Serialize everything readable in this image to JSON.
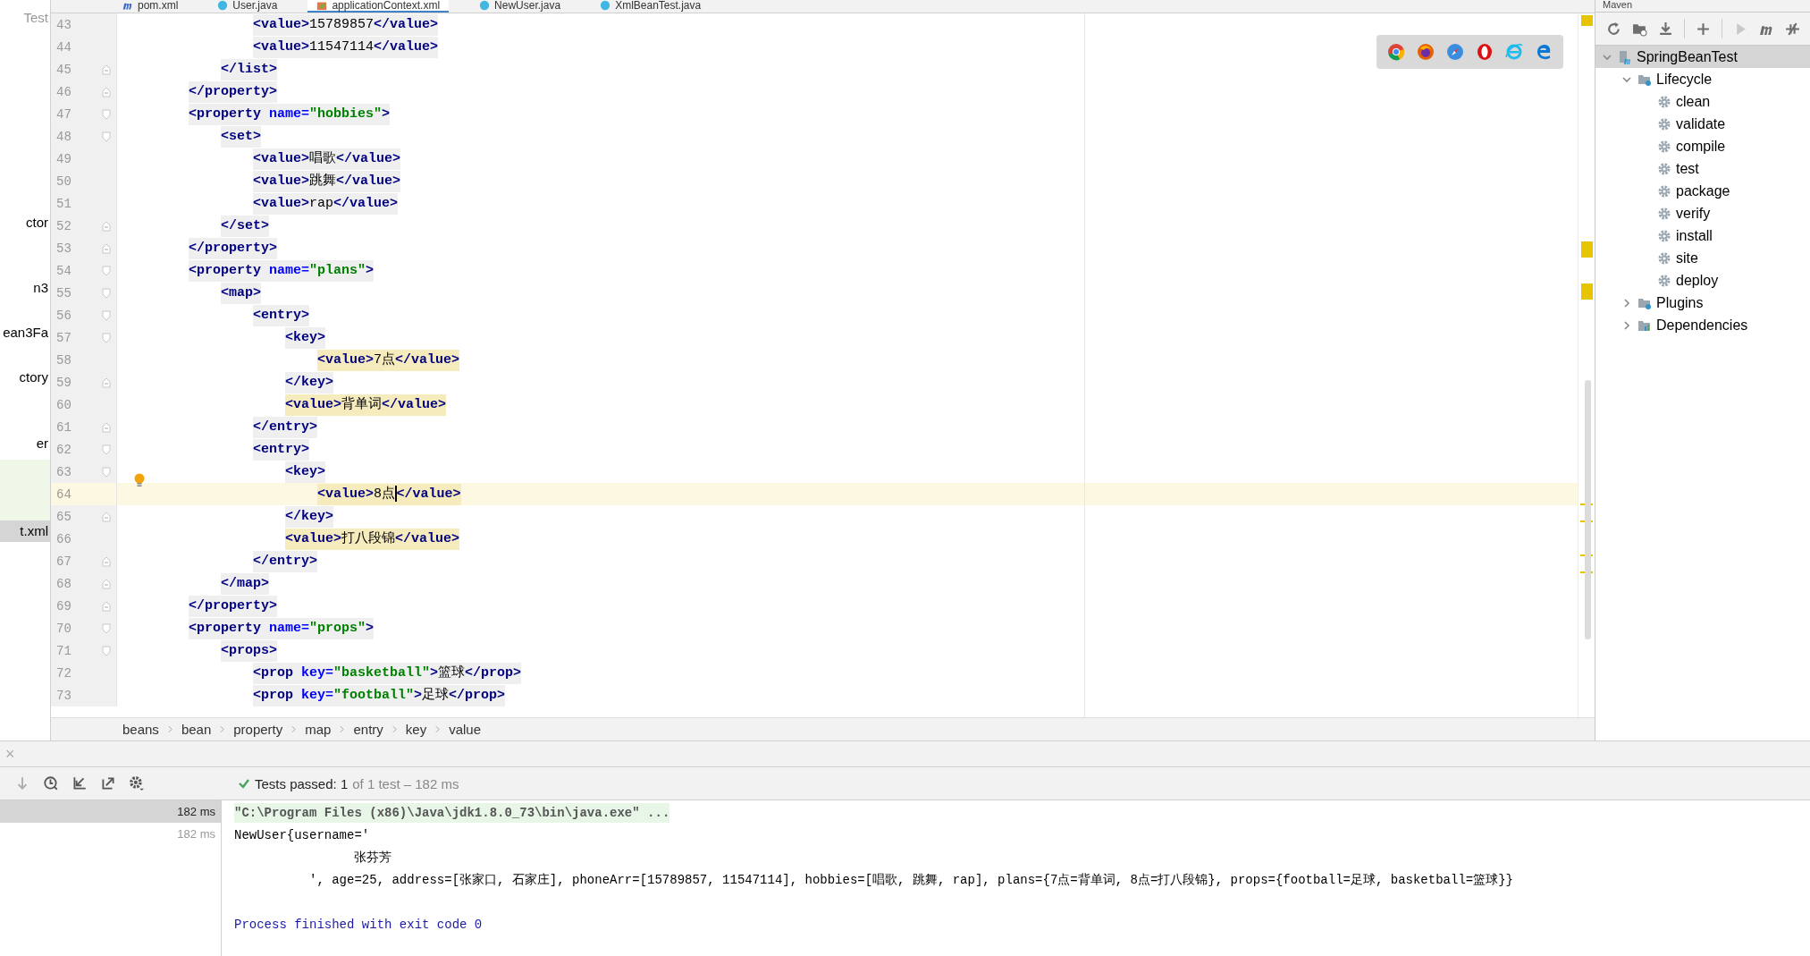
{
  "project_panel": {
    "items": [
      {
        "label": "Test",
        "selected": false
      },
      {
        "label": "ctor",
        "selected": false
      },
      {
        "label": "n3",
        "selected": false
      },
      {
        "label": "ean3Fa",
        "selected": false
      },
      {
        "label": "ctory",
        "selected": false
      },
      {
        "label": "er",
        "selected": false
      },
      {
        "label": "t.xml",
        "selected": true
      }
    ]
  },
  "editor_tabs": [
    {
      "label": "pom.xml",
      "kind": "maven",
      "selected": false
    },
    {
      "label": "User.java",
      "kind": "class",
      "selected": false
    },
    {
      "label": "applicationContext.xml",
      "kind": "spring",
      "selected": true
    },
    {
      "label": "NewUser.java",
      "kind": "class",
      "selected": false
    },
    {
      "label": "XmlBeanTest.java",
      "kind": "class",
      "selected": false
    }
  ],
  "editor": {
    "lines": [
      {
        "number": "43",
        "kind": "element",
        "matched": false,
        "tokens": [
          {
            "kind": "tag",
            "t": "<value>"
          },
          {
            "kind": "text",
            "t": "15789857"
          },
          {
            "kind": "tag",
            "t": "</value>"
          }
        ]
      },
      {
        "number": "44",
        "kind": "element",
        "matched": false,
        "tokens": [
          {
            "kind": "tag",
            "t": "<value>"
          },
          {
            "kind": "text",
            "t": "11547114"
          },
          {
            "kind": "tag",
            "t": "</value>"
          }
        ]
      },
      {
        "number": "45",
        "kind": "close_tag",
        "matched": false,
        "tokens": [
          {
            "kind": "tag",
            "t": "</list>"
          }
        ]
      },
      {
        "number": "46",
        "kind": "close_tag",
        "matched": false,
        "tokens": [
          {
            "kind": "tag",
            "t": "</property>"
          }
        ]
      },
      {
        "number": "47",
        "kind": "open_tag",
        "matched": false,
        "tokens": [
          {
            "kind": "tag",
            "t": "<property "
          },
          {
            "kind": "attr",
            "t": "name="
          },
          {
            "kind": "str",
            "t": "\"hobbies\""
          },
          {
            "kind": "tag",
            "t": ">"
          }
        ]
      },
      {
        "number": "48",
        "kind": "open_tag",
        "matched": false,
        "tokens": [
          {
            "kind": "tag",
            "t": "<set>"
          }
        ]
      },
      {
        "number": "49",
        "kind": "element",
        "matched": false,
        "tokens": [
          {
            "kind": "tag",
            "t": "<value>"
          },
          {
            "kind": "text",
            "t": "唱歌"
          },
          {
            "kind": "tag",
            "t": "</value>"
          }
        ]
      },
      {
        "number": "50",
        "kind": "element",
        "matched": false,
        "tokens": [
          {
            "kind": "tag",
            "t": "<value>"
          },
          {
            "kind": "text",
            "t": "跳舞"
          },
          {
            "kind": "tag",
            "t": "</value>"
          }
        ]
      },
      {
        "number": "51",
        "kind": "element",
        "matched": false,
        "tokens": [
          {
            "kind": "tag",
            "t": "<value>"
          },
          {
            "kind": "text",
            "t": "rap"
          },
          {
            "kind": "tag",
            "t": "</value>"
          }
        ]
      },
      {
        "number": "52",
        "kind": "close_tag",
        "matched": false,
        "tokens": [
          {
            "kind": "tag",
            "t": "</set>"
          }
        ]
      },
      {
        "number": "53",
        "kind": "close_tag",
        "matched": false,
        "tokens": [
          {
            "kind": "tag",
            "t": "</property>"
          }
        ]
      },
      {
        "number": "54",
        "kind": "open_tag",
        "matched": false,
        "tokens": [
          {
            "kind": "tag",
            "t": "<property "
          },
          {
            "kind": "attr",
            "t": "name="
          },
          {
            "kind": "str",
            "t": "\"plans\""
          },
          {
            "kind": "tag",
            "t": ">"
          }
        ]
      },
      {
        "number": "55",
        "kind": "open_tag",
        "matched": false,
        "tokens": [
          {
            "kind": "tag",
            "t": "<map>"
          }
        ]
      },
      {
        "number": "56",
        "kind": "open_tag",
        "matched": false,
        "tokens": [
          {
            "kind": "tag",
            "t": "<entry>"
          }
        ]
      },
      {
        "number": "57",
        "kind": "open_tag",
        "matched": false,
        "tokens": [
          {
            "kind": "tag",
            "t": "<key>"
          }
        ]
      },
      {
        "number": "58",
        "kind": "element",
        "matched": true,
        "tokens": [
          {
            "kind": "tag",
            "t": "<value>"
          },
          {
            "kind": "text",
            "t": "7点"
          },
          {
            "kind": "tag",
            "t": "</value>"
          }
        ]
      },
      {
        "number": "59",
        "kind": "close_tag",
        "matched": false,
        "tokens": [
          {
            "kind": "tag",
            "t": "</key>"
          }
        ]
      },
      {
        "number": "60",
        "kind": "element",
        "matched": true,
        "tokens": [
          {
            "kind": "tag",
            "t": "<value>"
          },
          {
            "kind": "text",
            "t": "背单词"
          },
          {
            "kind": "tag",
            "t": "</value>"
          }
        ]
      },
      {
        "number": "61",
        "kind": "close_tag",
        "matched": false,
        "tokens": [
          {
            "kind": "tag",
            "t": "</entry>"
          }
        ]
      },
      {
        "number": "62",
        "kind": "open_tag",
        "matched": false,
        "tokens": [
          {
            "kind": "tag",
            "t": "<entry>"
          }
        ]
      },
      {
        "number": "63",
        "kind": "open_tag",
        "matched": false,
        "tokens": [
          {
            "kind": "tag",
            "t": "<key>"
          }
        ]
      },
      {
        "number": "64",
        "kind": "element",
        "matched": true,
        "current": true,
        "tokens": [
          {
            "kind": "tag",
            "t": "<value>"
          },
          {
            "kind": "text",
            "t": "8点",
            "caret": true
          },
          {
            "kind": "tag",
            "t": "</value>"
          }
        ]
      },
      {
        "number": "65",
        "kind": "close_tag",
        "matched": false,
        "tokens": [
          {
            "kind": "tag",
            "t": "</key>"
          }
        ]
      },
      {
        "number": "66",
        "kind": "element",
        "matched": true,
        "tokens": [
          {
            "kind": "tag",
            "t": "<value>"
          },
          {
            "kind": "text",
            "t": "打八段锦"
          },
          {
            "kind": "tag",
            "t": "</value>"
          }
        ]
      },
      {
        "number": "67",
        "kind": "close_tag",
        "matched": false,
        "tokens": [
          {
            "kind": "tag",
            "t": "</entry>"
          }
        ]
      },
      {
        "number": "68",
        "kind": "close_tag",
        "matched": false,
        "tokens": [
          {
            "kind": "tag",
            "t": "</map>"
          }
        ]
      },
      {
        "number": "69",
        "kind": "close_tag",
        "matched": false,
        "tokens": [
          {
            "kind": "tag",
            "t": "</property>"
          }
        ]
      },
      {
        "number": "70",
        "kind": "open_tag",
        "matched": false,
        "tokens": [
          {
            "kind": "tag",
            "t": "<property "
          },
          {
            "kind": "attr",
            "t": "name="
          },
          {
            "kind": "str",
            "t": "\"props\""
          },
          {
            "kind": "tag",
            "t": ">"
          }
        ]
      },
      {
        "number": "71",
        "kind": "open_tag",
        "matched": false,
        "tokens": [
          {
            "kind": "tag",
            "t": "<props>"
          }
        ]
      },
      {
        "number": "72",
        "kind": "element",
        "matched": false,
        "tokens": [
          {
            "kind": "tag",
            "t": "<prop "
          },
          {
            "kind": "attr",
            "t": "key="
          },
          {
            "kind": "str",
            "t": "\"basketball\""
          },
          {
            "kind": "tag",
            "t": ">"
          },
          {
            "kind": "text",
            "t": "篮球"
          },
          {
            "kind": "tag",
            "t": "</prop>"
          }
        ]
      },
      {
        "number": "73",
        "kind": "element",
        "matched": false,
        "tokens": [
          {
            "kind": "tag",
            "t": "<prop "
          },
          {
            "kind": "attr",
            "t": "key="
          },
          {
            "kind": "str",
            "t": "\"football\""
          },
          {
            "kind": "tag",
            "t": ">"
          },
          {
            "kind": "text",
            "t": "足球"
          },
          {
            "kind": "tag",
            "t": "</prop>"
          }
        ]
      }
    ],
    "breadcrumbs": [
      "beans",
      "bean",
      "property",
      "map",
      "entry",
      "key",
      "value"
    ]
  },
  "maven": {
    "title": "Maven",
    "tree": [
      {
        "label": "SpringBeanTest",
        "kind": "project",
        "expanded": true,
        "selected": true,
        "children": [
          {
            "label": "Lifecycle",
            "kind": "folder",
            "expanded": true,
            "selected": false,
            "children": [
              {
                "label": "clean",
                "kind": "goal",
                "selected": false
              },
              {
                "label": "validate",
                "kind": "goal",
                "selected": false
              },
              {
                "label": "compile",
                "kind": "goal",
                "selected": false
              },
              {
                "label": "test",
                "kind": "goal",
                "selected": false
              },
              {
                "label": "package",
                "kind": "goal",
                "selected": false
              },
              {
                "label": "verify",
                "kind": "goal",
                "selected": false
              },
              {
                "label": "install",
                "kind": "goal",
                "selected": false
              },
              {
                "label": "site",
                "kind": "goal",
                "selected": false
              },
              {
                "label": "deploy",
                "kind": "goal",
                "selected": false
              }
            ]
          },
          {
            "label": "Plugins",
            "kind": "folder",
            "expanded": false,
            "selected": false
          },
          {
            "label": "Dependencies",
            "kind": "dependencies",
            "expanded": false,
            "selected": false
          }
        ]
      }
    ]
  },
  "run_panel": {
    "close": "×",
    "status": "Tests passed: 1",
    "status_detail": "of 1 test – 182 ms",
    "tests": [
      {
        "duration": "182 ms",
        "selected": true
      },
      {
        "duration": "182 ms",
        "selected": false
      }
    ],
    "console": [
      {
        "kind": "command",
        "text": "\"C:\\Program Files (x86)\\Java\\jdk1.8.0_73\\bin\\java.exe\" ..."
      },
      {
        "kind": "output",
        "text": "NewUser{username='"
      },
      {
        "kind": "output",
        "text": "                张芬芳"
      },
      {
        "kind": "output",
        "text": "          ', age=25, address=[张家口, 石家庄], phoneArr=[15789857, 11547114], hobbies=[唱歌, 跳舞, rap], plans={7点=背单词, 8点=打八段锦}, props={football=足球, basketball=篮球}}"
      },
      {
        "kind": "blank"
      },
      {
        "kind": "exit",
        "text": "Process finished with exit code 0"
      }
    ]
  }
}
